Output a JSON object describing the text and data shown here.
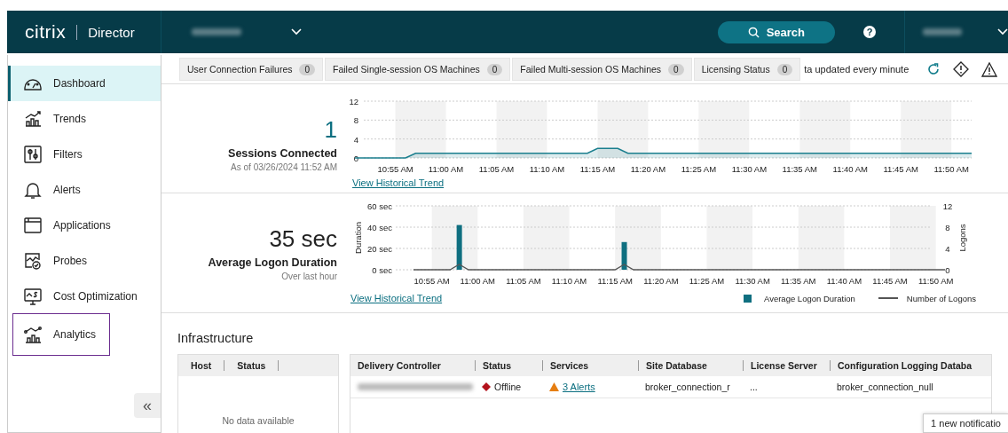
{
  "header": {
    "logo": "citrix",
    "product": "Director",
    "search_label": "Search",
    "help_label": "?"
  },
  "sidebar": {
    "items": [
      {
        "label": "Dashboard",
        "selected": true,
        "highlighted": false
      },
      {
        "label": "Trends",
        "selected": false,
        "highlighted": false
      },
      {
        "label": "Filters",
        "selected": false,
        "highlighted": false
      },
      {
        "label": "Alerts",
        "selected": false,
        "highlighted": false
      },
      {
        "label": "Applications",
        "selected": false,
        "highlighted": false
      },
      {
        "label": "Probes",
        "selected": false,
        "highlighted": false
      },
      {
        "label": "Cost Optimization",
        "selected": false,
        "highlighted": false
      },
      {
        "label": "Analytics",
        "selected": false,
        "highlighted": true
      }
    ],
    "collapse_label": "«"
  },
  "filters": [
    {
      "label": "User Connection Failures",
      "count": "0"
    },
    {
      "label": "Failed Single-session OS Machines",
      "count": "0"
    },
    {
      "label": "Failed Multi-session OS Machines",
      "count": "0"
    },
    {
      "label": "Licensing Status",
      "count": "0"
    }
  ],
  "update_note": "ta updated every minute",
  "sessions": {
    "value": "1",
    "label": "Sessions Connected",
    "sub": "As of 03/26/2024 11:52 AM",
    "link": "View Historical Trend",
    "chart_data": {
      "type": "area",
      "categories": [
        null,
        null,
        null,
        null,
        "10:55 AM",
        null,
        null,
        null,
        null,
        "11:00 AM",
        null,
        null,
        null,
        null,
        "11:05 AM",
        null,
        null,
        null,
        null,
        "11:10 AM",
        null,
        null,
        null,
        null,
        "11:15 AM",
        null,
        null,
        null,
        null,
        "11:20 AM",
        null,
        null,
        null,
        null,
        "11:25 AM",
        null,
        null,
        null,
        null,
        "11:30 AM",
        null,
        null,
        null,
        null,
        "11:35 AM",
        null,
        null,
        null,
        null,
        "11:40 AM",
        null,
        null,
        null,
        null,
        "11:45 AM",
        null,
        null,
        null,
        null,
        "11:50 AM",
        null,
        null
      ],
      "series": [
        {
          "color": "#1b7f8e",
          "values": [
            0,
            0,
            0,
            0,
            0,
            0,
            1,
            1,
            1,
            1,
            1,
            1,
            1,
            1,
            1,
            1,
            1,
            1,
            1,
            1,
            1,
            1,
            1,
            1,
            2,
            2,
            2,
            1,
            1,
            1,
            1,
            1,
            1,
            1,
            1,
            1,
            1,
            1,
            1,
            1,
            1,
            1,
            1,
            1,
            1,
            1,
            1,
            1,
            1,
            1,
            1,
            1,
            1,
            1,
            1,
            1,
            1,
            1,
            1,
            1,
            1,
            1
          ]
        }
      ],
      "ylim": [
        0,
        12
      ],
      "yticks": [
        0,
        4,
        8,
        12
      ]
    }
  },
  "logon": {
    "value": "35 sec",
    "label": "Average Logon Duration",
    "sub": "Over last hour",
    "link": "View Historical Trend",
    "chart_data": {
      "type": "bar",
      "categories": [
        null,
        null,
        "10:55 AM",
        null,
        null,
        null,
        null,
        "11:00 AM",
        null,
        null,
        null,
        null,
        "11:05 AM",
        null,
        null,
        null,
        null,
        "11:10 AM",
        null,
        null,
        null,
        null,
        "11:15 AM",
        null,
        null,
        null,
        null,
        "11:20 AM",
        null,
        null,
        null,
        null,
        "11:25 AM",
        null,
        null,
        null,
        null,
        "11:30 AM",
        null,
        null,
        null,
        null,
        "11:35 AM",
        null,
        null,
        null,
        null,
        "11:40 AM",
        null,
        null,
        null,
        null,
        "11:45 AM",
        null,
        null,
        null,
        null,
        "11:50 AM",
        null
      ],
      "series": [
        {
          "name": "Average Logon Duration",
          "color": "#0f6f80",
          "values": [
            null,
            null,
            null,
            null,
            null,
            42,
            null,
            null,
            null,
            null,
            null,
            null,
            null,
            null,
            null,
            null,
            null,
            null,
            null,
            null,
            null,
            null,
            null,
            26,
            null,
            null,
            null,
            null,
            null,
            null,
            null,
            null,
            null,
            null,
            null,
            null,
            null,
            null,
            null,
            null,
            null,
            null,
            null,
            null,
            null,
            null,
            null,
            null,
            null,
            null,
            null,
            null,
            null,
            null,
            null,
            null,
            null,
            null,
            null
          ]
        },
        {
          "name": "Number of Logons",
          "type": "line",
          "axis": "y2",
          "color": "#555555",
          "values": [
            0,
            0,
            0,
            0,
            0,
            1,
            0,
            0,
            0,
            0,
            0,
            0,
            0,
            0,
            0,
            0,
            0,
            0,
            0,
            0,
            0,
            0,
            0,
            1,
            0,
            0,
            0,
            0,
            0,
            0,
            0,
            0,
            0,
            0,
            0,
            0,
            0,
            0,
            0,
            0,
            0,
            0,
            0,
            0,
            0,
            0,
            0,
            0,
            0,
            0,
            0,
            0,
            0,
            0,
            0,
            0,
            0,
            0,
            0
          ]
        }
      ],
      "ylim": [
        0,
        60
      ],
      "ylabel": "Duration",
      "y2label": "Logons",
      "y2lim": [
        0,
        12
      ],
      "y2ticks": [
        0,
        4,
        8,
        12
      ],
      "yticks": [
        {
          "value": 0,
          "label": "0 sec"
        },
        {
          "value": 20,
          "label": "20 sec"
        },
        {
          "value": 40,
          "label": "40 sec"
        },
        {
          "value": 60,
          "label": "60 sec"
        }
      ]
    }
  },
  "infrastructure": {
    "title": "Infrastructure",
    "hosts": {
      "columns": [
        "Host",
        "Status"
      ],
      "empty": "No data available"
    },
    "controllers": {
      "columns": [
        "Delivery Controller",
        "Status",
        "Services",
        "Site Database",
        "License Server",
        "Configuration Logging Databa"
      ],
      "rows": [
        {
          "status": "Offline",
          "services": "3 Alerts",
          "site_db": "broker_connection_r",
          "license": "...",
          "config_db": "broker_connection_null"
        }
      ]
    }
  },
  "toast": "1 new notificatio"
}
